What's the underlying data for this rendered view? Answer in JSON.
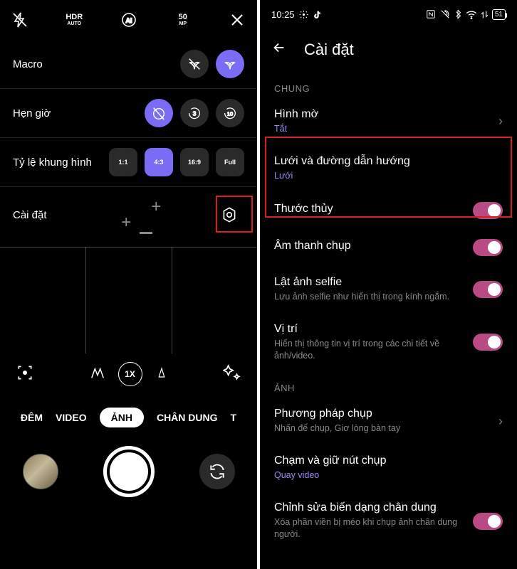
{
  "left": {
    "topIcons": {
      "hdr": "HDR",
      "hdrSub": "AUTO",
      "ai": "AI",
      "mp": "50",
      "mpSub": "MP"
    },
    "rows": {
      "macro": "Macro",
      "timer": "Hẹn giờ",
      "timerOptions": [
        "3",
        "10"
      ],
      "ratio": "Tỷ lệ khung hình",
      "ratioOptions": [
        "1:1",
        "4:3",
        "16:9",
        "Full"
      ],
      "settings": "Cài đặt"
    },
    "zoom": {
      "level": "1X"
    },
    "modes": [
      "ĐÊM",
      "VIDEO",
      "ẢNH",
      "CHÂN DUNG",
      "T"
    ],
    "activeMode": 2
  },
  "right": {
    "status": {
      "time": "10:25",
      "battery": "51"
    },
    "header": "Cài đặt",
    "sections": [
      {
        "label": "CHUNG"
      },
      {
        "label": "ẢNH"
      }
    ],
    "items": {
      "watermark": {
        "title": "Hình mờ",
        "sub": "Tắt"
      },
      "grid": {
        "title": "Lưới và đường dẫn hướng",
        "sub": "Lưới"
      },
      "level": {
        "title": "Thước thủy"
      },
      "shutterSound": {
        "title": "Âm thanh chụp"
      },
      "selfie": {
        "title": "Lật ảnh selfie",
        "sub": "Lưu ảnh selfie như hiển thị trong kính ngắm."
      },
      "location": {
        "title": "Vị trí",
        "sub": "Hiển thị thông tin vị trí trong các chi tiết về ảnh/video."
      },
      "captureMethod": {
        "title": "Phương pháp chụp",
        "sub": "Nhấn để chụp, Giơ lòng bàn tay"
      },
      "holdShutter": {
        "title": "Chạm và giữ nút chụp",
        "sub": "Quay video"
      },
      "distortion": {
        "title": "Chỉnh sửa biến dạng chân dung",
        "sub": "Xóa phần viền bị méo khi chụp ảnh chân dung người."
      }
    }
  }
}
